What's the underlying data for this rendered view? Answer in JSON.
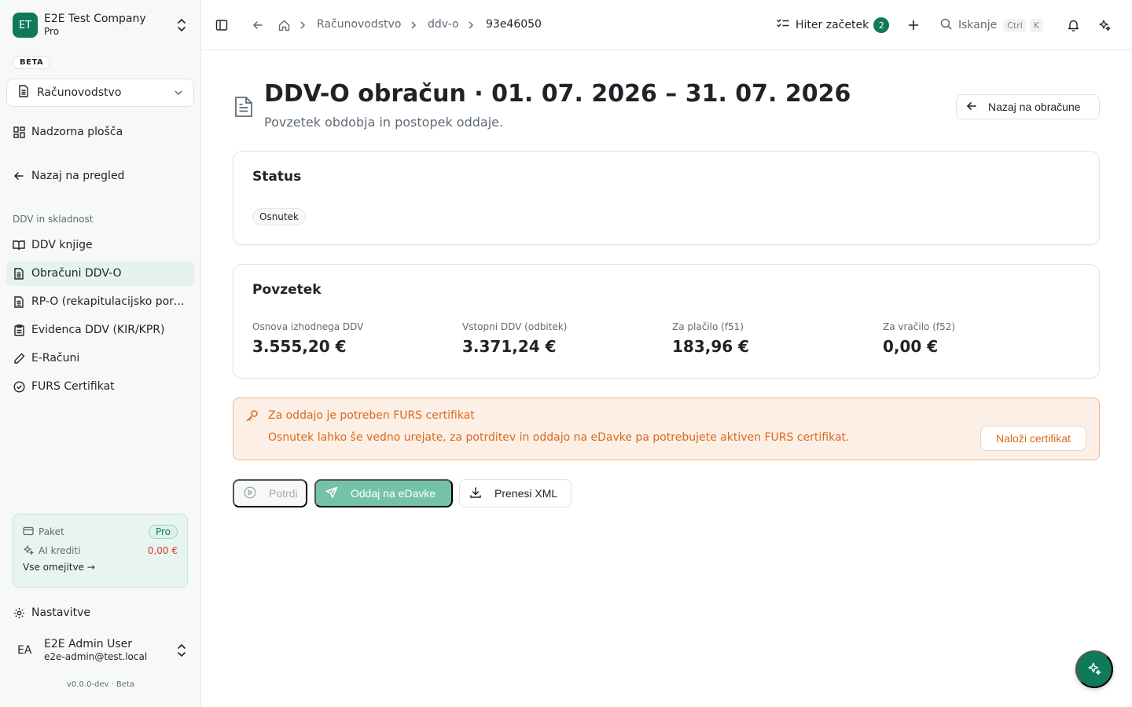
{
  "company": {
    "initials": "ET",
    "name": "E2E Test Company",
    "plan": "Pro"
  },
  "beta_label": "BETA",
  "module_select": {
    "value": "Računovodstvo"
  },
  "sidebar": {
    "dashboard": "Nadzorna plošča",
    "back": "Nazaj na pregled",
    "section_label": "DDV in skladnost",
    "items": [
      {
        "label": "DDV knjige",
        "icon": "book-icon"
      },
      {
        "label": "Obračuni DDV-O",
        "icon": "file-text-icon",
        "active": true
      },
      {
        "label": "RP-O (rekapitulacijsko poročilo)",
        "icon": "file-text-icon"
      },
      {
        "label": "Evidenca DDV (KIR/KPR)",
        "icon": "clipboard-icon"
      },
      {
        "label": "E-Računi",
        "icon": "pen-icon"
      },
      {
        "label": "FURS Certifikat",
        "icon": "check-circle-icon"
      }
    ],
    "settings": "Nastavitve"
  },
  "package": {
    "label": "Paket",
    "plan": "Pro",
    "credits_label": "AI krediti",
    "credits_value": "0,00 €",
    "limits_link": "Vse omejitve →"
  },
  "user": {
    "initials": "EA",
    "name": "E2E Admin User",
    "email": "e2e-admin@test.local"
  },
  "version": "v0.0.0-dev · Beta",
  "breadcrumb": [
    "Računovodstvo",
    "ddv-o",
    "93e46050"
  ],
  "header": {
    "quick_start": "Hiter začetek",
    "quick_start_count": "2",
    "search": "Iskanje",
    "kbd_ctrl": "Ctrl",
    "kbd_k": "K"
  },
  "page": {
    "title": "DDV-O obračun · 01. 07. 2026 – 31. 07. 2026",
    "subtitle": "Povzetek obdobja in postopek oddaje.",
    "back_button": "Nazaj na obračune"
  },
  "status_card": {
    "title": "Status",
    "badge": "Osnutek"
  },
  "summary_card": {
    "title": "Povzetek",
    "metrics": [
      {
        "label": "Osnova izhodnega DDV",
        "value": "3.555,20 €"
      },
      {
        "label": "Vstopni DDV (odbitek)",
        "value": "3.371,24 €"
      },
      {
        "label": "Za plačilo (f51)",
        "value": "183,96 €"
      },
      {
        "label": "Za vračilo (f52)",
        "value": "0,00 €"
      }
    ]
  },
  "alert": {
    "title": "Za oddajo je potreben FURS certifikat",
    "text": "Osnutek lahko še vedno urejate, za potrditev in oddajo na eDavke pa potrebujete aktiven FURS certifikat.",
    "button": "Naloži certifikat"
  },
  "actions": {
    "confirm": "Potrdi",
    "submit": "Oddaj na eDavke",
    "download": "Prenesi XML"
  },
  "colors": {
    "brand": "#0f7a5a",
    "warning": "#d86a1c",
    "danger": "#d23d2f"
  }
}
